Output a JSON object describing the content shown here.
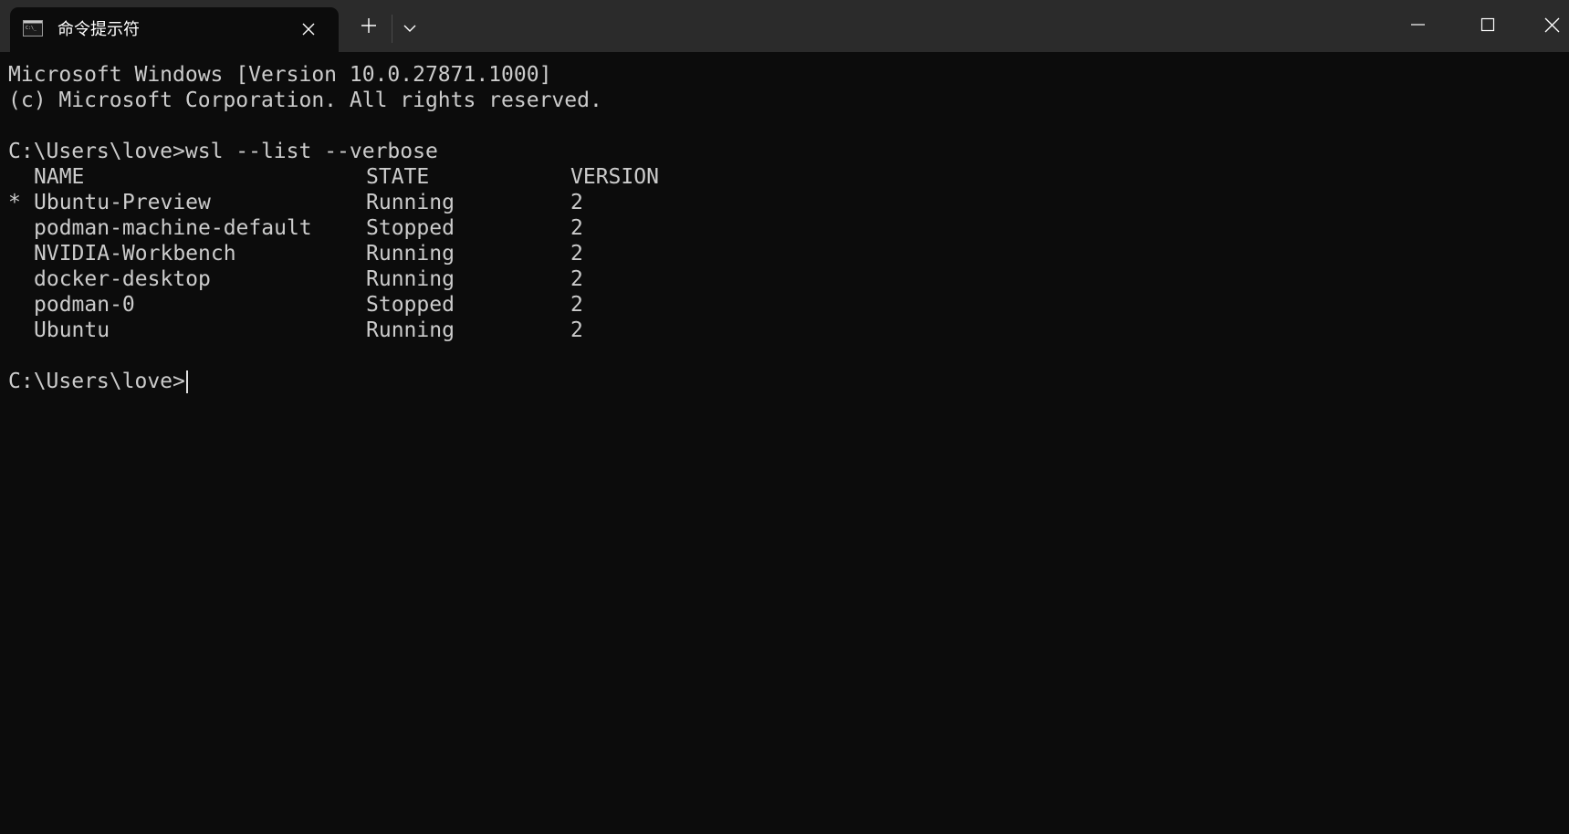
{
  "window": {
    "tab_title": "命令提示符",
    "tab_icon": "cmd-terminal-icon",
    "buttons": {
      "tab_close": "close-icon",
      "new_tab": "plus-icon",
      "dropdown": "chevron-down-icon",
      "minimize": "minimize-icon",
      "maximize": "maximize-icon",
      "close": "close-icon"
    }
  },
  "terminal": {
    "banner_line1": "Microsoft Windows [Version 10.0.27871.1000]",
    "banner_line2": "(c) Microsoft Corporation. All rights reserved.",
    "prompt": "C:\\Users\\love>",
    "command": "wsl --list --verbose",
    "table": {
      "headers": {
        "name": "NAME",
        "state": "STATE",
        "version": "VERSION"
      },
      "rows": [
        {
          "marker": "*",
          "name": "Ubuntu-Preview",
          "state": "Running",
          "version": "2"
        },
        {
          "marker": "",
          "name": "podman-machine-default",
          "state": "Stopped",
          "version": "2"
        },
        {
          "marker": "",
          "name": "NVIDIA-Workbench",
          "state": "Running",
          "version": "2"
        },
        {
          "marker": "",
          "name": "docker-desktop",
          "state": "Running",
          "version": "2"
        },
        {
          "marker": "",
          "name": "podman-0",
          "state": "Stopped",
          "version": "2"
        },
        {
          "marker": "",
          "name": "Ubuntu",
          "state": "Running",
          "version": "2"
        }
      ]
    },
    "final_prompt": "C:\\Users\\love>"
  },
  "colors": {
    "titlebar_bg": "#2b2b2b",
    "terminal_bg": "#0c0c0c",
    "terminal_text": "#cccccc",
    "chrome_icon": "#ffffff"
  }
}
